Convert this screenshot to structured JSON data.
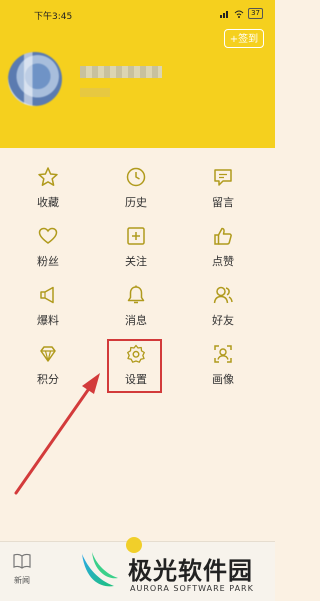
{
  "status_bar": {
    "time": "下午3:45",
    "battery": "37"
  },
  "header": {
    "checkin_label": "+签到"
  },
  "menu": {
    "favorites": "收藏",
    "history": "历史",
    "messages": "留言",
    "fans": "粉丝",
    "following": "关注",
    "likes": "点赞",
    "tips": "爆料",
    "notifications": "消息",
    "friends": "好友",
    "points": "积分",
    "settings": "设置",
    "portrait": "画像"
  },
  "bottom_nav": {
    "news": "新闻"
  },
  "watermark": {
    "title": "极光软件园",
    "subtitle": "AURORA SOFTWARE PARK"
  },
  "colors": {
    "accent": "#f5d01e",
    "icon": "#b09a1c",
    "highlight": "#d23a3a"
  }
}
